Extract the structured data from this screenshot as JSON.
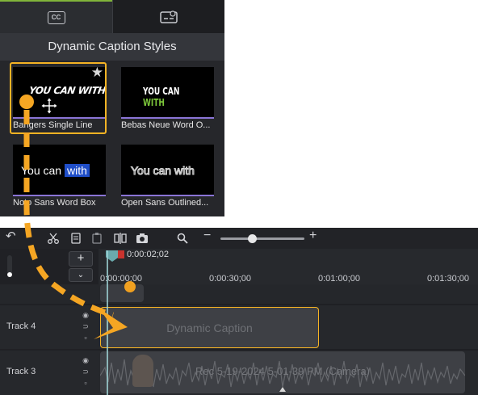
{
  "panel": {
    "title": "Dynamic Caption Styles",
    "tabs": [
      {
        "icon": "closed-caption-icon",
        "label": "CC"
      },
      {
        "icon": "caption-settings-icon"
      }
    ],
    "styles": [
      {
        "label": "Bangers Single Line",
        "preview": [
          "YOU CAN WITH"
        ],
        "selected": true
      },
      {
        "label": "Bebas Neue Word O...",
        "preview": [
          "YOU CAN",
          "WITH"
        ],
        "highlight_color": "#7cc63a"
      },
      {
        "label": "Noto Sans Word Box",
        "preview": [
          "You can",
          "with"
        ],
        "box_color": "#1f4ec8"
      },
      {
        "label": "Open Sans Outlined...",
        "preview": [
          "You can with"
        ]
      }
    ]
  },
  "timeline": {
    "current_time": "0:00:02;02",
    "ruler_labels": [
      "0:00:00;00",
      "0:00:30;00",
      "0:01:00;00",
      "0:01:30;00"
    ],
    "tracks": [
      {
        "name": "Track 4",
        "clip": "Dynamic Caption"
      },
      {
        "name": "Track 3",
        "clip": "Rec 5-19-2024 5-01-39 PM (Camera)"
      }
    ],
    "zoom_level": 0.33
  },
  "colors": {
    "selection": "#f5b324",
    "accent_green": "#80b43a",
    "drag_arrow": "#f5a623"
  }
}
